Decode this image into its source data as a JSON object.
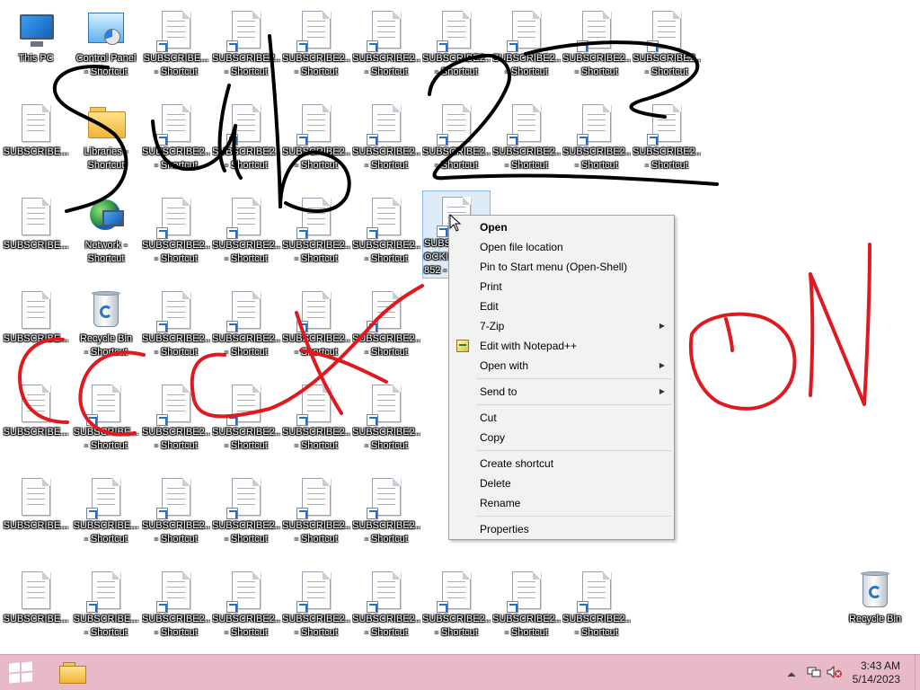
{
  "desktop": {
    "icons": {
      "this_pc": "This PC",
      "control_panel": [
        "Control Panel",
        "- Shortcut"
      ],
      "libraries": [
        "Libraries -",
        "Shortcut"
      ],
      "network": [
        "Network -",
        "Shortcut"
      ],
      "recycle_bin_shortcut": [
        "Recycle Bin",
        "- Shortcut"
      ],
      "recycle_bin": "Recycle Bin",
      "file_short": "SUBSCRIBE...",
      "file_shortcut_name": "SUBSCRIBE2...",
      "file_shortcut_name_b": "SUBSCRIBE...",
      "shortcut_suffix": "- Shortcut",
      "selected_file": [
        "SUBS",
        "OCKI",
        "852 -"
      ]
    }
  },
  "context_menu": {
    "items": [
      {
        "label": "Open"
      },
      {
        "label": "Open file location"
      },
      {
        "label": "Pin to Start menu (Open-Shell)"
      },
      {
        "label": "Print"
      },
      {
        "label": "Edit"
      },
      {
        "label": "7-Zip"
      },
      {
        "label": "Edit with Notepad++"
      },
      {
        "label": "Open with"
      },
      {
        "label": "Send to"
      },
      {
        "label": "Cut"
      },
      {
        "label": "Copy"
      },
      {
        "label": "Create shortcut"
      },
      {
        "label": "Delete"
      },
      {
        "label": "Rename"
      },
      {
        "label": "Properties"
      }
    ],
    "submenu_glyph": "▶"
  },
  "taskbar": {
    "clock_time": "3:43 AM",
    "clock_date": "5/14/2023",
    "color": "#e8b9c6"
  },
  "colors": {
    "black_ink": "#000000",
    "red_ink": "#e0191f",
    "menu_bg": "#f2f2f2"
  }
}
